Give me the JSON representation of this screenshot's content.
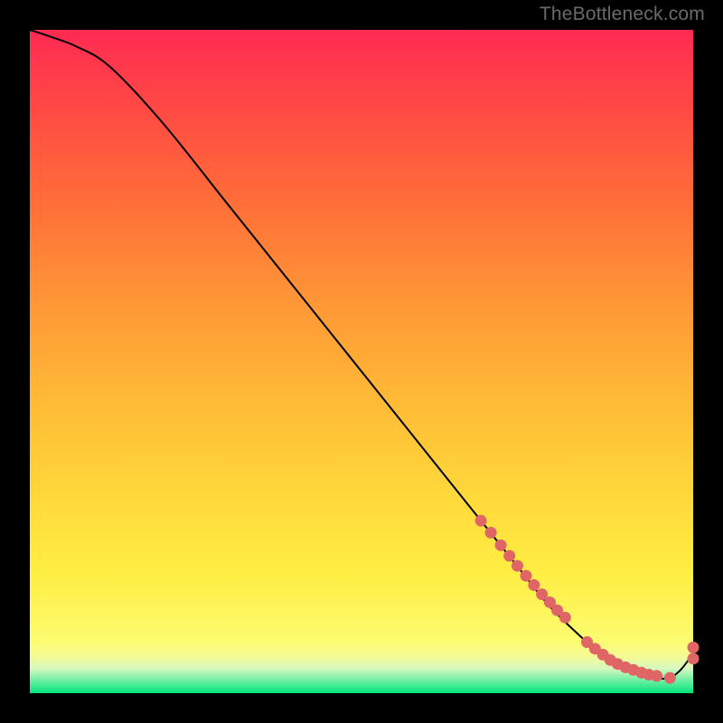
{
  "watermark": "TheBottleneck.com",
  "chart_data": {
    "type": "line",
    "title": "",
    "xlabel": "",
    "ylabel": "",
    "xlim": [
      0,
      100
    ],
    "ylim": [
      0,
      100
    ],
    "grid": false,
    "legend": false,
    "series": [
      {
        "name": "curve",
        "x": [
          0,
          3,
          7,
          12,
          20,
          30,
          40,
          50,
          60,
          68,
          74,
          78,
          82,
          86,
          90,
          93,
          96,
          98,
          100
        ],
        "y": [
          100,
          99,
          97.5,
          94.5,
          86,
          73.5,
          61,
          48.5,
          36,
          26,
          18.5,
          13.5,
          9.5,
          6,
          3.7,
          2.6,
          2.2,
          3.4,
          6
        ],
        "style": "black-thin-line"
      },
      {
        "name": "dots",
        "x": [
          68,
          69.5,
          71,
          72.3,
          73.5,
          74.8,
          76,
          77.2,
          78.4,
          79.5,
          80.7,
          84,
          85.2,
          86.4,
          87.5,
          88.6,
          89.8,
          91,
          92.2,
          93.3,
          94.5,
          96.5,
          100,
          100
        ],
        "y": [
          26,
          24.2,
          22.3,
          20.7,
          19.2,
          17.7,
          16.3,
          14.9,
          13.7,
          12.5,
          11.4,
          7.7,
          6.7,
          5.8,
          5.0,
          4.4,
          3.9,
          3.5,
          3.1,
          2.8,
          2.6,
          2.3,
          5.2,
          6.9
        ],
        "style": "salmon-dot"
      }
    ]
  }
}
